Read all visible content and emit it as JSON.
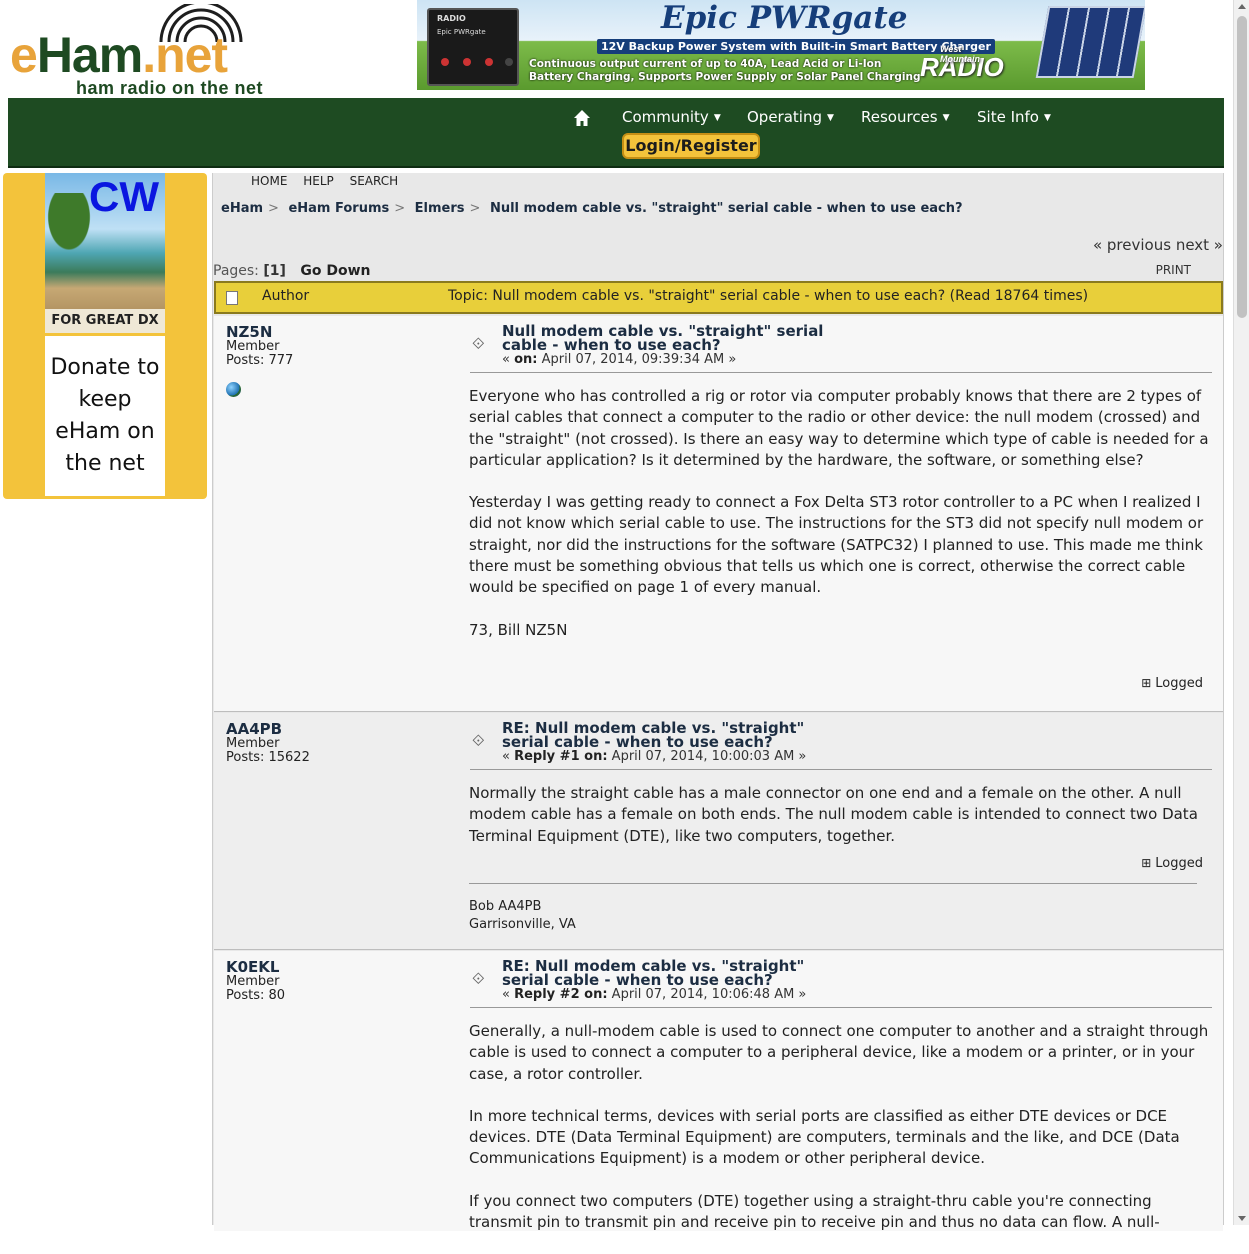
{
  "logo": {
    "eham_prefix": "eHam",
    "dot_net": ".net",
    "tagline": "ham radio on the net"
  },
  "banner": {
    "title": "Epic PWRgate",
    "subtitle": "12V Backup Power System with Built-in Smart Battery Charger",
    "line1": "Continuous output current of up to 40A, Lead Acid or Li-Ion",
    "line2": "Battery Charging, Supports Power Supply or Solar Panel Charging",
    "brand_top": "West Mountain",
    "brand": "RADIO",
    "device_label": "Epic PWRgate",
    "device_brand": "RADIO"
  },
  "nav": {
    "home_icon": "home-icon",
    "items": [
      {
        "label": "Community"
      },
      {
        "label": "Operating"
      },
      {
        "label": "Resources"
      },
      {
        "label": "Site Info"
      }
    ],
    "login": "Login/Register"
  },
  "sidebar": {
    "ad_cw": "CW",
    "ad_dx": "FOR GREAT DX",
    "donate": "Donate to keep eHam on the net"
  },
  "top_links": {
    "home": "HOME",
    "help": "HELP",
    "search": "SEARCH"
  },
  "breadcrumb": [
    "eHam",
    "eHam Forums",
    "Elmers",
    "Null modem cable vs. \"straight\" serial cable - when to use each?"
  ],
  "prevnext": "« previous next »",
  "pages": {
    "label": "Pages:",
    "current": "[1]",
    "go_down": "Go Down",
    "print": "PRINT"
  },
  "topic_bar": {
    "author": "Author",
    "title": "Topic: Null modem cable vs. \"straight\" serial cable - when to use each?  (Read 18764 times)"
  },
  "posts": [
    {
      "username": "NZ5N",
      "role": "Member",
      "posts": "Posts: 777",
      "subject": "Null modem cable vs. \"straight\" serial cable - when to use each?",
      "meta_label": "on:",
      "meta_date": "April 07, 2014, 09:39:34 AM »",
      "body": [
        "Everyone who has controlled a rig or rotor via computer probably knows that there are 2 types of serial cables that connect a computer to the radio or other device: the null modem (crossed) and the \"straight\" (not crossed).  Is there an easy way to determine which type of cable is needed for a particular application?  Is it determined by the hardware, the software, or something else?",
        "Yesterday I was getting ready to connect a Fox Delta ST3 rotor controller to a PC when I realized I did not know which serial cable to use.  The instructions for the ST3 did not specify null modem or straight, nor did the instructions for the software (SATPC32) I planned to use.  This made me think there must be something obvious that tells us which one is correct, otherwise the correct cable would be specified on page 1 of every manual.",
        "73, Bill NZ5N"
      ],
      "logged": "Logged"
    },
    {
      "username": "AA4PB",
      "role": "Member",
      "posts": "Posts: 15622",
      "subject": "RE: Null modem cable vs. \"straight\" serial cable - when to use each?",
      "meta_label": "Reply #1 on:",
      "meta_date": "April 07, 2014, 10:00:03 AM »",
      "body": [
        "Normally the straight cable has a male connector on one end and a female on the other. A null modem cable has a female on both ends. The null modem cable is intended to connect two Data Terminal Equipment (DTE), like two computers, together."
      ],
      "logged": "Logged",
      "signature": [
        "Bob  AA4PB",
        "Garrisonville, VA"
      ]
    },
    {
      "username": "K0EKL",
      "role": "Member",
      "posts": "Posts: 80",
      "subject": "RE: Null modem cable vs. \"straight\" serial cable - when to use each?",
      "meta_label": "Reply #2 on:",
      "meta_date": "April 07, 2014, 10:06:48 AM »",
      "body": [
        "Generally, a null-modem cable is used to connect one computer to another and a straight through cable is used to connect a computer to a peripheral device, like a modem or a printer, or in your case, a rotor controller.",
        "In more technical terms, devices with serial ports are classified as either DTE devices or DCE devices. DTE (Data Terminal Equipment) are computers, terminals and the like, and DCE (Data Communications Equipment) is a modem or other peripheral device.",
        "If you connect two computers (DTE) together using a straight-thru cable you're connecting transmit pin to transmit pin and receive pin to receive pin and thus no data can flow. A null-"
      ]
    }
  ],
  "colors": {
    "nav_green": "#1e4b22",
    "accent_gold": "#f3c33b",
    "topic_bar": "#e8cf3a",
    "logo_orange": "#e8a33a"
  }
}
